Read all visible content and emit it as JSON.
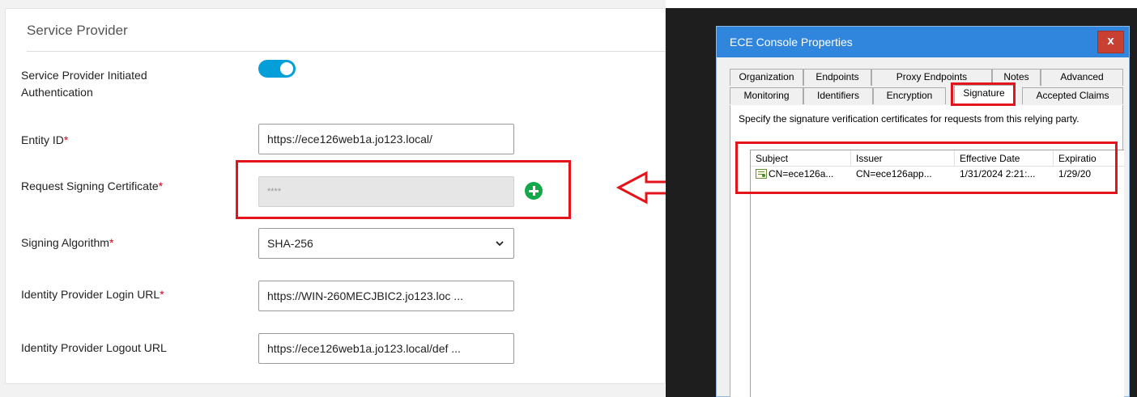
{
  "service_provider": {
    "title": "Service Provider",
    "fields": {
      "sp_initiated_auth": {
        "label_line1": "Service Provider Initiated",
        "label_line2": "Authentication",
        "enabled": true
      },
      "entity_id": {
        "label": "Entity ID",
        "value": "https://ece126web1a.jo123.local/"
      },
      "request_signing_certificate": {
        "label": "Request Signing Certificate",
        "value": "****"
      },
      "signing_algorithm": {
        "label": "Signing Algorithm",
        "value": "SHA-256"
      },
      "idp_login_url": {
        "label": "Identity Provider Login URL",
        "value": "https://WIN-260MECJBIC2.jo123.loc ..."
      },
      "idp_logout_url": {
        "label": "Identity Provider Logout URL",
        "value": "https://ece126web1a.jo123.local/def ..."
      }
    },
    "required_marker": "*"
  },
  "dialog": {
    "title": "ECE Console Properties",
    "close_glyph": "x",
    "tabs_row1": [
      "Organization",
      "Endpoints",
      "Proxy Endpoints",
      "Notes",
      "Advanced"
    ],
    "tabs_row2": [
      "Monitoring",
      "Identifiers",
      "Encryption",
      "Signature",
      "Accepted Claims"
    ],
    "active_tab": "Signature",
    "description": "Specify the signature verification certificates for requests from this relying party.",
    "columns": [
      "Subject",
      "Issuer",
      "Effective Date",
      "Expiratio"
    ],
    "rows": [
      {
        "subject": "CN=ece126a...",
        "issuer": "CN=ece126app...",
        "effective_date": "1/31/2024 2:21:...",
        "expiration": "1/29/20"
      }
    ]
  },
  "colors": {
    "accent": "#049fd9",
    "highlight": "#e4141d",
    "add_button": "#14a84a",
    "dialog_titlebar": "#2f86dc"
  },
  "icons": [
    "toggle-switch",
    "plus-circle-icon",
    "chevron-down-icon",
    "left-arrow-icon",
    "close-icon",
    "certificate-icon"
  ]
}
